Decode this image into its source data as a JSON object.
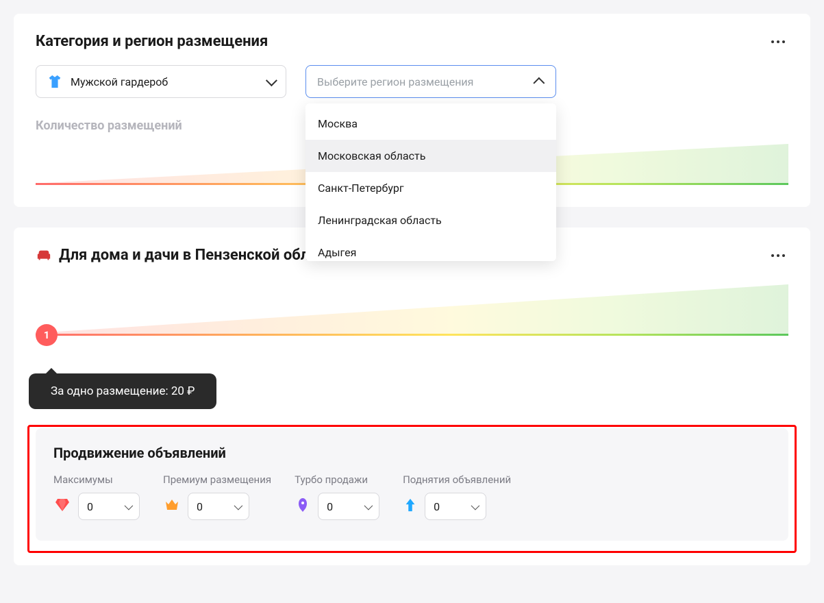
{
  "card1": {
    "title": "Категория и регион размещения",
    "category_select": {
      "value": "Мужской гардероб"
    },
    "region_select": {
      "placeholder": "Выберите регион размещения",
      "options": [
        "Москва",
        "Московская область",
        "Санкт-Петербург",
        "Ленинградская область",
        "Адыгея"
      ],
      "hover_index": 1
    },
    "section_label": "Количество размещений"
  },
  "card2": {
    "title": "Для дома и дачи в Пензенской области",
    "slider_value": "1",
    "tooltip": "За одно размещение: 20 ₽",
    "promo": {
      "title": "Продвижение объявлений",
      "items": [
        {
          "label": "Максимумы",
          "value": "0",
          "icon": "diamond"
        },
        {
          "label": "Премиум размещения",
          "value": "0",
          "icon": "crown"
        },
        {
          "label": "Турбо продажи",
          "value": "0",
          "icon": "rocket"
        },
        {
          "label": "Поднятия объявлений",
          "value": "0",
          "icon": "arrowup"
        }
      ]
    }
  }
}
